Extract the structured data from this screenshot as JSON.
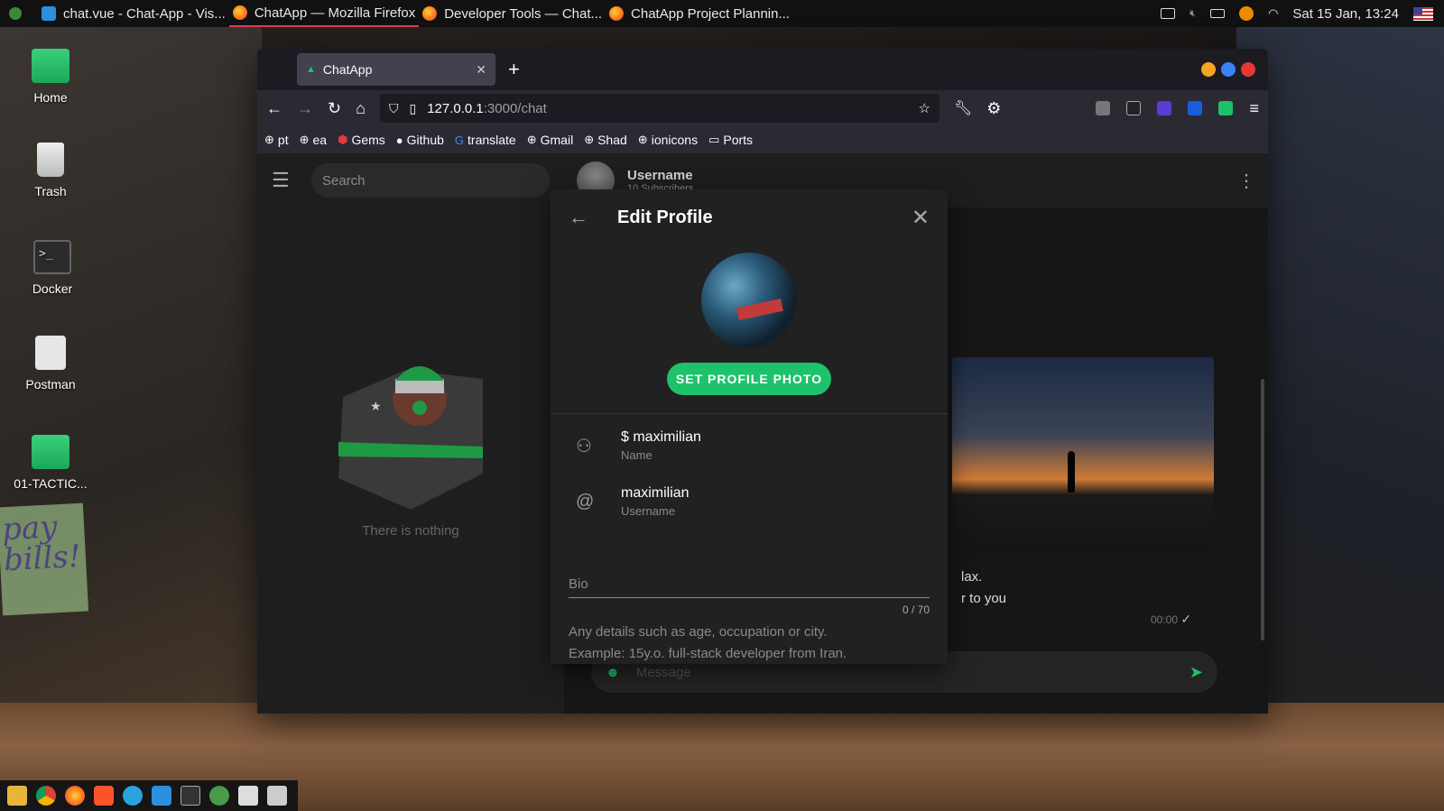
{
  "topbar": {
    "tasks": [
      {
        "label": "chat.vue - Chat-App - Vis...",
        "icon": "vscode-icon"
      },
      {
        "label": "ChatApp — Mozilla Firefox",
        "icon": "firefox-icon",
        "active": true
      },
      {
        "label": "Developer Tools — Chat...",
        "icon": "firefox-icon"
      },
      {
        "label": "ChatApp Project Plannin...",
        "icon": "firefox-icon"
      }
    ],
    "clock": "Sat 15 Jan, 13:24"
  },
  "desktop": {
    "icons": [
      {
        "label": "Home",
        "icon": "home-folder-icon"
      },
      {
        "label": "Trash",
        "icon": "trash-icon"
      },
      {
        "label": "Docker",
        "icon": "terminal-icon"
      },
      {
        "label": "Postman",
        "icon": "postman-icon"
      },
      {
        "label": "01-TACTIC...",
        "icon": "folder-icon"
      }
    ],
    "postit": "pay bills!"
  },
  "browser": {
    "tab_title": "ChatApp",
    "url_host": "127.0.0.1",
    "url_path": ":3000/chat",
    "bookmarks": [
      "pt",
      "ea",
      "Gems",
      "Github",
      "translate",
      "Gmail",
      "Shad",
      "ionicons",
      "Ports"
    ]
  },
  "app": {
    "search_placeholder": "Search",
    "empty_text": "There is nothing",
    "chat_header": {
      "username": "Username",
      "subscribers": "10 Subscribers"
    },
    "message": {
      "line1": "lax.",
      "line2": "r to you",
      "time": "00:00"
    },
    "message_placeholder": "Message"
  },
  "edit_profile": {
    "title": "Edit Profile",
    "set_photo_label": "SET PROFILE PHOTO",
    "name_value": "$ maximilian",
    "name_label": "Name",
    "username_value": "maximilian",
    "username_label": "Username",
    "bio_placeholder": "Bio",
    "bio_counter": "0 / 70",
    "bio_hint_line1": "Any details such as age, occupation or city.",
    "bio_hint_line2": "Example: 15y.o. full-stack developer from Iran."
  },
  "colors": {
    "accent": "#1ec26b",
    "panel": "#212121",
    "firefox_tab": "#42414d"
  }
}
